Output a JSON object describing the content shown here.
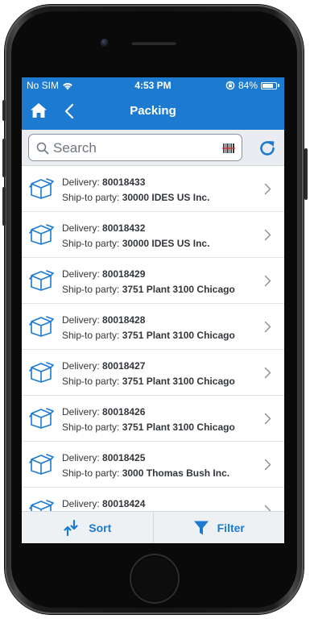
{
  "status_bar": {
    "carrier": "No SIM",
    "time": "4:53 PM",
    "battery_percent": "84%",
    "battery_level": 0.84,
    "icons": [
      "wifi-icon",
      "orientation-lock-icon",
      "battery-icon"
    ]
  },
  "nav": {
    "title": "Packing",
    "home_icon": "home-icon",
    "back_icon": "chevron-left-icon"
  },
  "search": {
    "placeholder": "Search",
    "icons": [
      "search-icon",
      "barcode-icon",
      "refresh-icon"
    ]
  },
  "list": {
    "delivery_label": "Delivery: ",
    "ship_to_label": "Ship-to party: ",
    "items": [
      {
        "delivery": "80018433",
        "ship_to": "30000 IDES US Inc."
      },
      {
        "delivery": "80018432",
        "ship_to": "30000 IDES US Inc."
      },
      {
        "delivery": "80018429",
        "ship_to": "3751 Plant 3100 Chicago"
      },
      {
        "delivery": "80018428",
        "ship_to": "3751 Plant 3100 Chicago"
      },
      {
        "delivery": "80018427",
        "ship_to": "3751 Plant 3100 Chicago"
      },
      {
        "delivery": "80018426",
        "ship_to": "3751 Plant 3100 Chicago"
      },
      {
        "delivery": "80018425",
        "ship_to": "3000 Thomas Bush Inc."
      },
      {
        "delivery": "80018424",
        "ship_to": ""
      }
    ]
  },
  "footer": {
    "sort_label": "Sort",
    "filter_label": "Filter"
  },
  "colors": {
    "brand": "#1c7ad0",
    "text": "#32363a",
    "chevron": "#8c9399"
  }
}
